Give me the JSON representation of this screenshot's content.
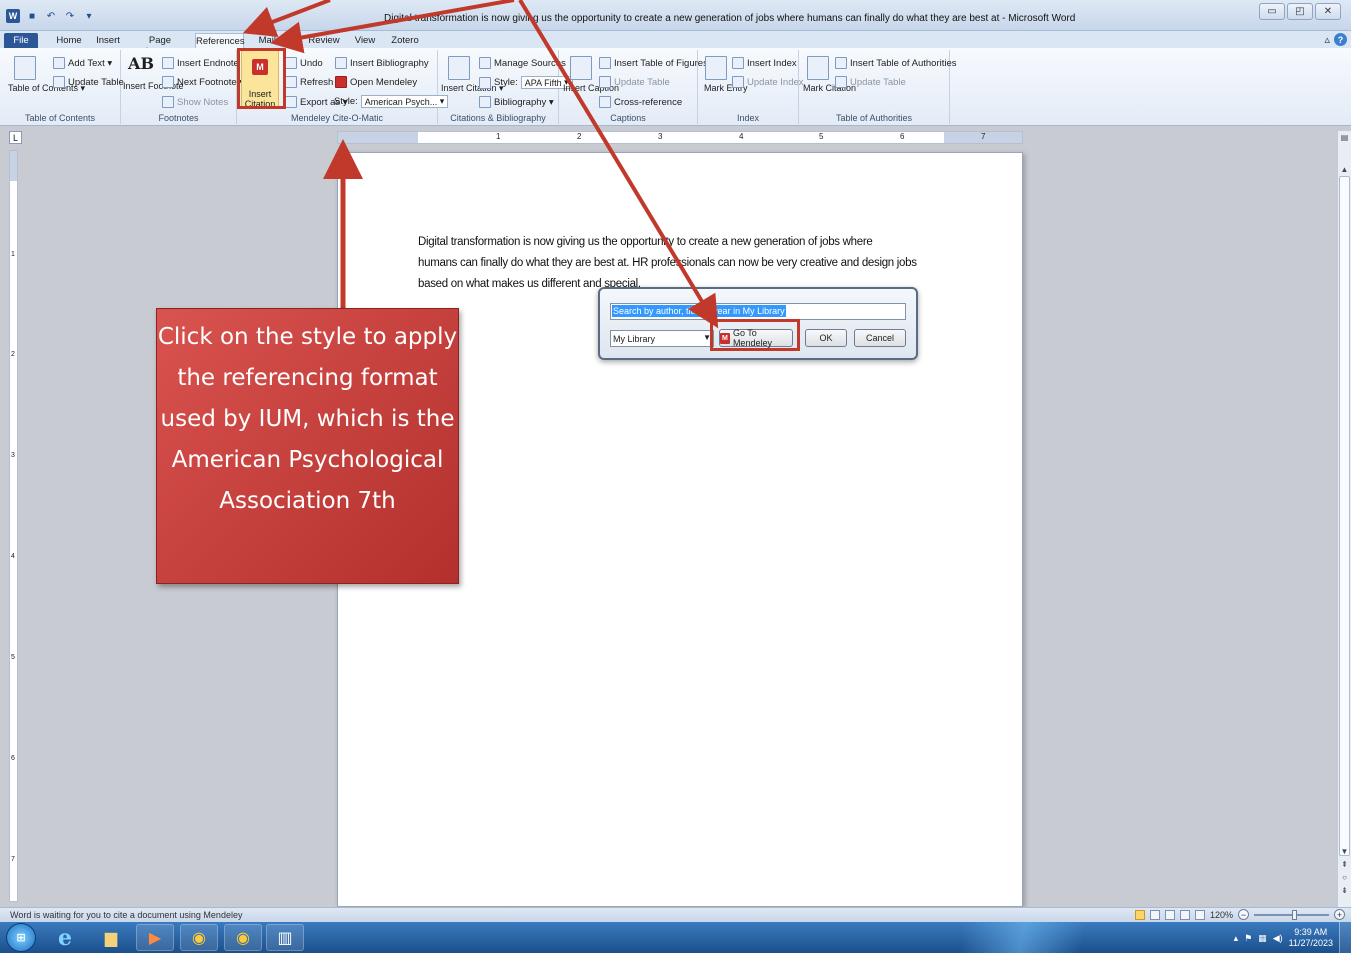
{
  "window": {
    "title": "Digital transformation is now giving us the opportunity to create a new generation of jobs where humans can finally do what they are best at  -  Microsoft Word",
    "word_icon": "W",
    "controls": [
      "▭",
      "◰",
      "✕"
    ]
  },
  "tabs": [
    "Home",
    "Insert",
    "Page Layout",
    "References",
    "Mailings",
    "Review",
    "View",
    "Zotero"
  ],
  "file_tab": "File",
  "active_tab": "References",
  "ribbon": {
    "toc": {
      "group_label": "Table of Contents",
      "add_text": "Add Text ▾",
      "update_table": "Update Table",
      "table_of_contents": "Table of Contents ▾"
    },
    "footnotes": {
      "group_label": "Footnotes",
      "insert_endnote": "Insert Endnote",
      "next_footnote": "Next Footnote ▾",
      "show_notes": "Show Notes",
      "insert_footnote": "Insert Footnote",
      "ab_glyph": "AB"
    },
    "mendeley": {
      "group_label": "Mendeley Cite-O-Matic",
      "insert_citation": "Insert Citation",
      "undo": "Undo",
      "refresh": "Refresh",
      "export_as": "Export as ▾",
      "insert_bibliography": "Insert Bibliography",
      "open_mendeley": "Open Mendeley",
      "style_label": "Style:",
      "style_value": "American Psych..."
    },
    "citations": {
      "group_label": "Citations & Bibliography",
      "manage_sources": "Manage Sources",
      "style_label": "Style:",
      "style_value": "APA Fifth",
      "bibliography": "Bibliography ▾",
      "insert_citation": "Insert Citation ▾"
    },
    "captions": {
      "group_label": "Captions",
      "insert_table_of_figures": "Insert Table of Figures",
      "update_table": "Update Table",
      "cross_reference": "Cross-reference",
      "insert_caption": "Insert Caption"
    },
    "index": {
      "group_label": "Index",
      "insert_index": "Insert Index",
      "update_index": "Update Index",
      "mark_entry": "Mark Entry"
    },
    "authorities": {
      "group_label": "Table of Authorities",
      "insert_table": "Insert Table of Authorities",
      "update_table": "Update Table",
      "mark_citation": "Mark Citation"
    }
  },
  "document": {
    "lines": [
      "Digital transformation is now giving us the opportunity to create a new generation of jobs where",
      "humans can finally do what they are best at. HR professionals can now be very creative and design jobs",
      "based on what makes us different and special."
    ]
  },
  "ruler_numbers": [
    "1",
    "2",
    "3",
    "4",
    "5",
    "6",
    "7"
  ],
  "ruler_left_numbers": [
    "1",
    "2",
    "3",
    "4",
    "5",
    "6",
    "7"
  ],
  "dialog": {
    "search_placeholder": "Search by author, title or year in My Library",
    "library_value": "My Library",
    "goto_label": "Go To Mendeley",
    "ok_label": "OK",
    "cancel_label": "Cancel"
  },
  "callout": {
    "text": "Click on the style to apply the referencing format used by IUM, which is the American Psychological Association 7th"
  },
  "status": {
    "text": "Word is waiting for you to cite a document using Mendeley",
    "zoom": "120%"
  },
  "taskbar": {
    "time": "9:39 AM",
    "date": "11/27/2023"
  },
  "colors": {
    "annotation_red": "#c0392b",
    "callout_fill": "#d9534f",
    "file_tab": "#2b5797",
    "highlight_yellow": "#fbe59a"
  }
}
